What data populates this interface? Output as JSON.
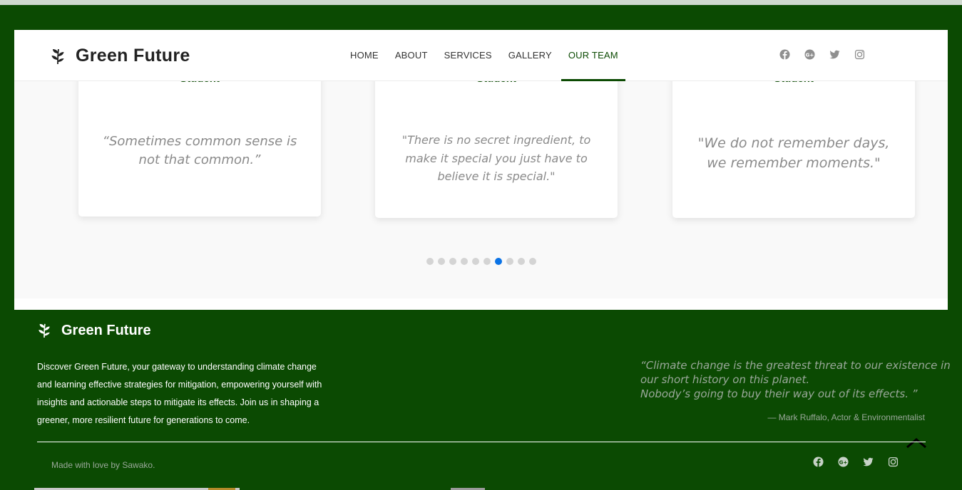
{
  "brand": {
    "name": "Green Future",
    "icon": "leaf-icon"
  },
  "nav": {
    "items": [
      {
        "label": "HOME"
      },
      {
        "label": "ABOUT"
      },
      {
        "label": "SERVICES"
      },
      {
        "label": "GALLERY"
      },
      {
        "label": "OUR TEAM",
        "active": true
      }
    ]
  },
  "social": [
    "facebook-icon",
    "google-plus-icon",
    "twitter-icon",
    "instagram-icon"
  ],
  "testimonials": {
    "cards": [
      {
        "role": "Student",
        "quote": "“Sometimes common sense is not that common.”"
      },
      {
        "role": "Student",
        "quote": "\"There is no secret ingredient, to make it special you just have to believe it is special.\""
      },
      {
        "role": "Student",
        "quote": "\"We do not remember days, we remember moments.\""
      }
    ],
    "dots_total": 10,
    "dots_active_index": 6
  },
  "footer": {
    "brand_name": "Green Future",
    "about": "Discover Green Future, your gateway to understanding climate change and learning effective strategies for mitigation, empowering yourself with insights and actionable steps to mitigate its effects. Join us in shaping a greener, more resilient future for generations to come.",
    "quote_line1": "“Climate change is the greatest threat to our existence in",
    "quote_line2": "our short history on this planet.",
    "quote_line3": "Nobody’s going to buy their way out of its effects. ”",
    "quote_author": "— Mark Ruffalo, Actor & Environmentalist",
    "credit": "Made with love by Sawako."
  },
  "colors": {
    "primary_green": "#0b4a02",
    "dot_active": "#0b73e6",
    "panel_bg": "#f9f9f9"
  }
}
